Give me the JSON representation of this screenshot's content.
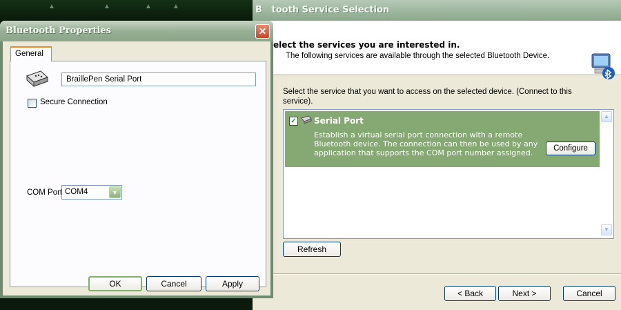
{
  "service_window": {
    "title": "Bluetooth Service Selection",
    "visible_title": "B   tooth Service Selection",
    "heading": "elect the services you are interested in.",
    "subheading": "The following services are available through the selected Bluetooth Device.",
    "instructions": "Select the service that you want to access on the selected device. (Connect to this service).",
    "services": [
      {
        "name": "Serial Port",
        "checked": true,
        "description": "Establish a virtual serial port connection with a remote Bluetooth device. The connection can then be used by any application that supports the COM port number assigned.",
        "configure_label": "Configure"
      }
    ],
    "refresh_label": "Refresh",
    "back_label": "< Back",
    "next_label": "Next >",
    "cancel_label": "Cancel",
    "highlight_color": "#86a873"
  },
  "properties_dialog": {
    "title": "Bluetooth Properties",
    "close_icon": "close-icon",
    "tab_label": "General",
    "port_name": "BraillePen Serial Port",
    "secure_label": "Secure Connection",
    "secure_checked": false,
    "com_label": "COM Port:",
    "com_value": "COM4",
    "ok_label": "OK",
    "cancel_label": "Cancel",
    "apply_label": "Apply"
  }
}
